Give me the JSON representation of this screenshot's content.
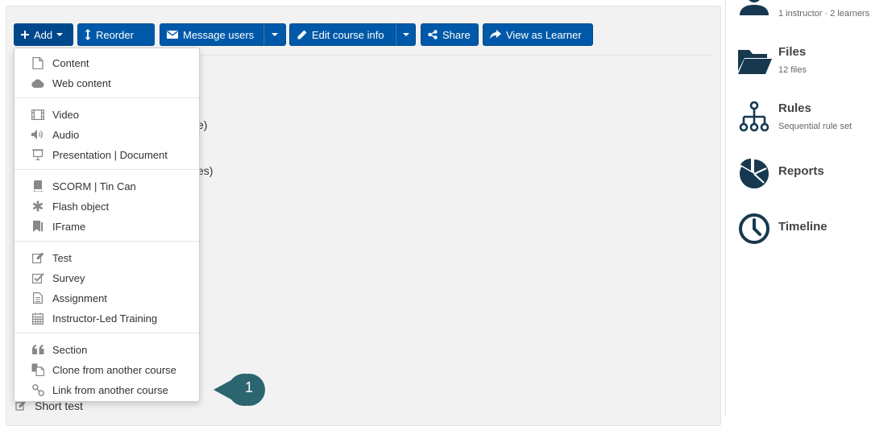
{
  "toolbar": {
    "add_label": "Add",
    "reorder_label": "Reorder",
    "message_users_label": "Message users",
    "edit_course_info_label": "Edit course info",
    "share_label": "Share",
    "view_as_learner_label": "View as Learner"
  },
  "background_fragments": {
    "fragment_1": "e)",
    "fragment_2": "es)",
    "last_item": "Short test"
  },
  "add_menu": {
    "items": [
      {
        "label": "Content",
        "icon": "document-icon"
      },
      {
        "label": "Web content",
        "icon": "cloud-icon"
      },
      {
        "label": "Video",
        "icon": "film-icon"
      },
      {
        "label": "Audio",
        "icon": "speaker-icon"
      },
      {
        "label": "Presentation | Document",
        "icon": "presentation-icon"
      },
      {
        "label": "SCORM | Tin Can",
        "icon": "book-icon"
      },
      {
        "label": "Flash object",
        "icon": "asterisk-icon"
      },
      {
        "label": "IFrame",
        "icon": "bookmark-icon"
      },
      {
        "label": "Test",
        "icon": "edit-icon"
      },
      {
        "label": "Survey",
        "icon": "check-square-icon"
      },
      {
        "label": "Assignment",
        "icon": "file-icon"
      },
      {
        "label": "Instructor-Led Training",
        "icon": "calendar-icon"
      },
      {
        "label": "Section",
        "icon": "quote-icon"
      },
      {
        "label": "Clone from another course",
        "icon": "copy-icon"
      },
      {
        "label": "Link from another course",
        "icon": "link-icon"
      }
    ]
  },
  "callout": {
    "number": "1"
  },
  "sidebar": {
    "users_subtitle": "1 instructor · 2 learners",
    "files": {
      "title": "Files",
      "subtitle": "12 files"
    },
    "rules": {
      "title": "Rules",
      "subtitle": "Sequential rule set"
    },
    "reports": {
      "title": "Reports"
    },
    "timeline": {
      "title": "Timeline"
    }
  },
  "colors": {
    "primary_button": "#0059a8",
    "sidebar_icon": "#16394f",
    "callout": "#2a6570"
  }
}
